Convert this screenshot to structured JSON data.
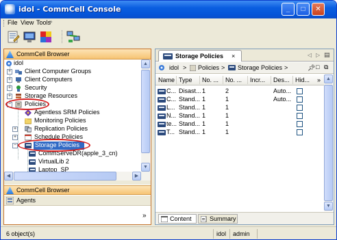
{
  "window": {
    "title": "idol - CommCell Console"
  },
  "menu": [
    "File",
    "View",
    "Tools"
  ],
  "toolbar": {
    "icons": [
      "notepad-icon",
      "monitor-icon",
      "colors-icon",
      "network-icon"
    ]
  },
  "left_pane": {
    "header": "CommCell Browser",
    "tree": [
      {
        "label": "idol",
        "icon": "commcell-icon"
      },
      {
        "label": "Client Computer Groups",
        "icon": "client-groups-icon"
      },
      {
        "label": "Client Computers",
        "icon": "client-computers-icon"
      },
      {
        "label": "Security",
        "icon": "security-icon"
      },
      {
        "label": "Storage Resources",
        "icon": "storage-resources-icon"
      },
      {
        "label": "Policies",
        "icon": "policies-icon"
      },
      {
        "label": "Agentless SRM Policies",
        "icon": "srm-policy-icon"
      },
      {
        "label": "Monitoring Policies",
        "icon": "folder-icon"
      },
      {
        "label": "Replication Policies",
        "icon": "replication-icon"
      },
      {
        "label": "Schedule Policies",
        "icon": "schedule-icon"
      },
      {
        "label": "Storage Policies",
        "icon": "storage-policy-icon"
      },
      {
        "label": "CommServeDR(apple_3_cn)",
        "icon": "storage-policy-icon"
      },
      {
        "label": "VirtualLib 2",
        "icon": "storage-policy-icon"
      },
      {
        "label": "Laptop_SP",
        "icon": "storage-policy-icon"
      }
    ],
    "bottom_header": "CommCell Browser",
    "agents_label": "Agents",
    "more_glyph": "»"
  },
  "right_pane": {
    "tab_label": "Storage Policies",
    "tab_close": "×",
    "breadcrumb": [
      "idol",
      ">",
      "Policies",
      ">",
      "Storage Policies",
      ">"
    ],
    "columns": [
      "Name",
      "Type",
      "No. ...",
      "No. ...",
      "Incr...",
      "Des...",
      "Hid..."
    ],
    "rows": [
      {
        "name": "C...",
        "type": "Disast...",
        "no1": "1",
        "no2": "2",
        "incr": "",
        "des": "Auto...",
        "hidden": false
      },
      {
        "name": "C...",
        "type": "Stand...",
        "no1": "1",
        "no2": "1",
        "incr": "",
        "des": "Auto...",
        "hidden": false
      },
      {
        "name": "L...",
        "type": "Stand...",
        "no1": "1",
        "no2": "1",
        "incr": "",
        "des": "",
        "hidden": false
      },
      {
        "name": "N...",
        "type": "Stand...",
        "no1": "1",
        "no2": "1",
        "incr": "",
        "des": "",
        "hidden": false
      },
      {
        "name": "te...",
        "type": "Stand...",
        "no1": "1",
        "no2": "1",
        "incr": "",
        "des": "",
        "hidden": false
      },
      {
        "name": "T...",
        "type": "Stand...",
        "no1": "1",
        "no2": "1",
        "incr": "",
        "des": "",
        "hidden": false
      }
    ],
    "bottom_tabs": [
      "Content",
      "Summary"
    ]
  },
  "status": {
    "objects": "6 object(s)",
    "host": "idol",
    "user": "admin"
  },
  "colors": {
    "title_blue": "#0a5ee0",
    "pane_orange": "#f6c373",
    "highlight": "#316ac5",
    "annotation_red": "#d42020"
  }
}
